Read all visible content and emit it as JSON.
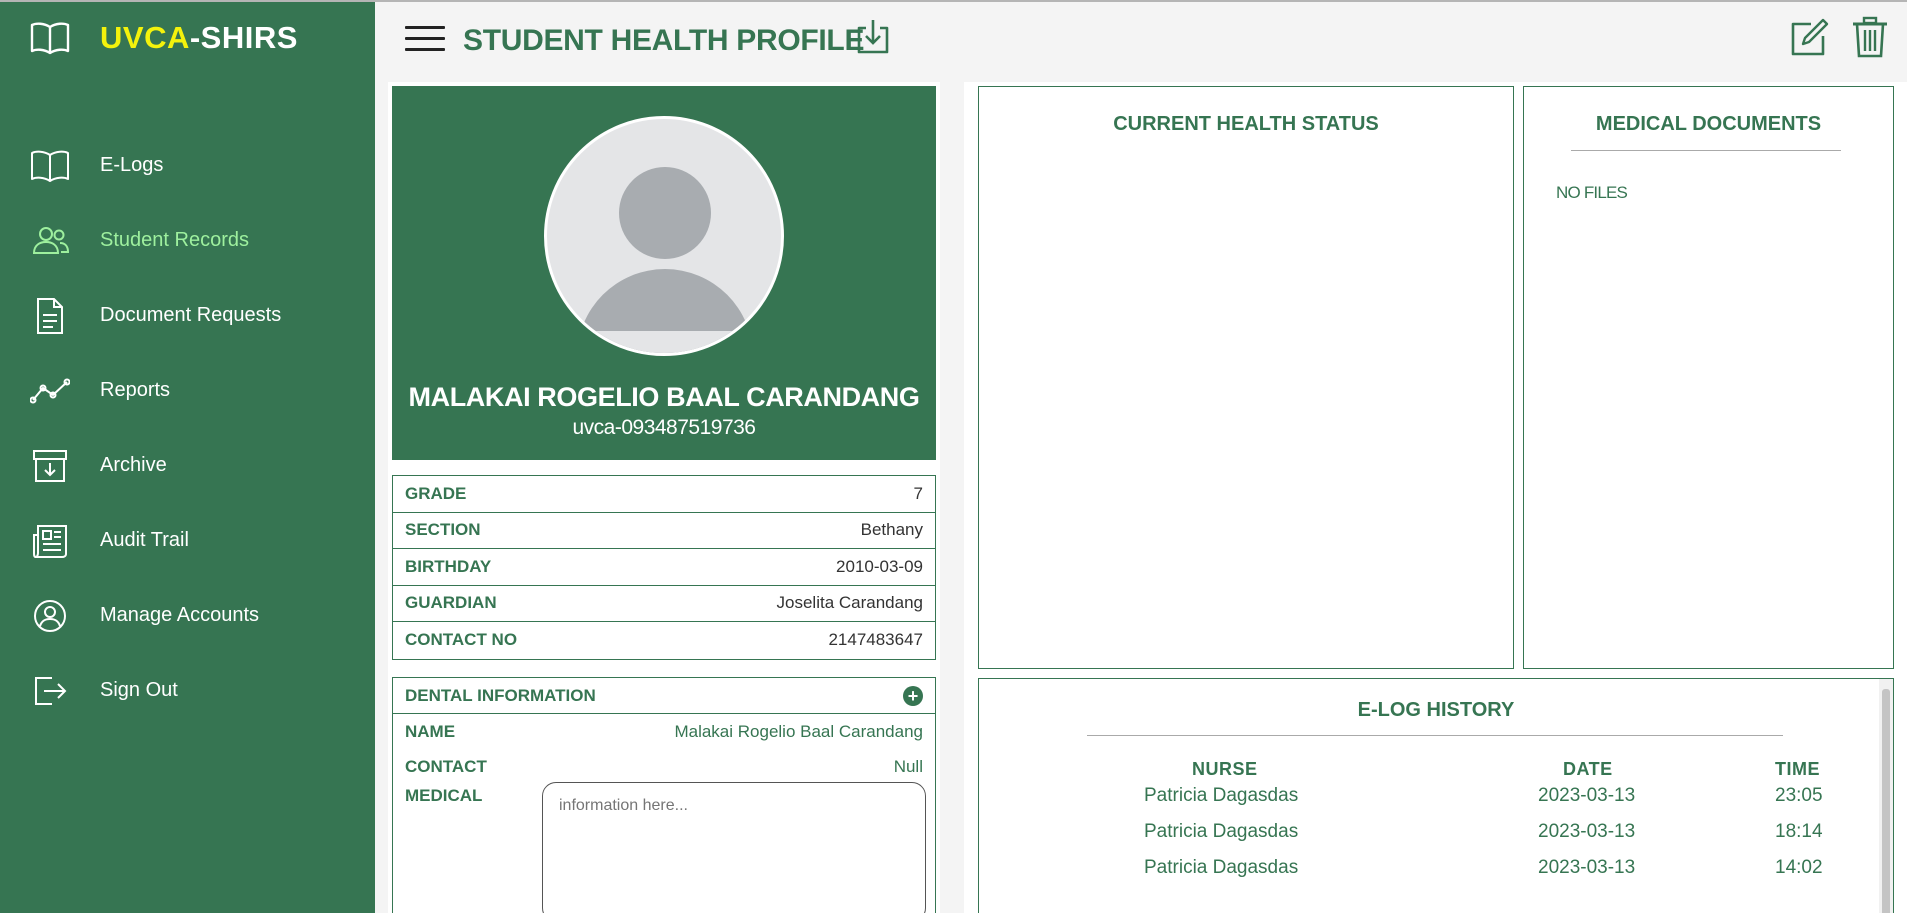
{
  "brand": {
    "part1": "UVCA",
    "part2": "-SHIRS"
  },
  "sidebar": {
    "items": [
      {
        "label": "E-Logs",
        "icon": "book-icon"
      },
      {
        "label": "Student Records",
        "icon": "users-icon",
        "active": true
      },
      {
        "label": "Document Requests",
        "icon": "document-icon"
      },
      {
        "label": "Reports",
        "icon": "chart-line-icon"
      },
      {
        "label": "Archive",
        "icon": "archive-icon"
      },
      {
        "label": "Audit Trail",
        "icon": "newspaper-icon"
      },
      {
        "label": "Manage Accounts",
        "icon": "user-circle-icon"
      },
      {
        "label": "Sign Out",
        "icon": "sign-out-icon"
      }
    ]
  },
  "header": {
    "title": "STUDENT HEALTH PROFILE"
  },
  "student": {
    "name": "MALAKAI ROGELIO BAAL CARANDANG",
    "id": "uvca-093487519736",
    "info": [
      {
        "key": "GRADE",
        "value": "7"
      },
      {
        "key": "SECTION",
        "value": "Bethany"
      },
      {
        "key": "BIRTHDAY",
        "value": "2010-03-09"
      },
      {
        "key": "GUARDIAN",
        "value": "Joselita Carandang"
      },
      {
        "key": "CONTACT NO",
        "value": "2147483647"
      }
    ]
  },
  "dental": {
    "title": "DENTAL INFORMATION",
    "name_label": "NAME",
    "name_value": "Malakai Rogelio Baal Carandang",
    "contact_label": "CONTACT",
    "contact_value": "Null",
    "medical_label": "MEDICAL",
    "medical_placeholder": "information here..."
  },
  "health": {
    "title": "CURRENT HEALTH STATUS"
  },
  "documents": {
    "title": "MEDICAL DOCUMENTS",
    "empty_text": "NO FILES"
  },
  "elog": {
    "title": "E-LOG HISTORY",
    "columns": [
      "NURSE",
      "DATE",
      "TIME"
    ],
    "rows": [
      {
        "nurse": "Patricia Dagasdas",
        "date": "2023-03-13",
        "time": "23:05"
      },
      {
        "nurse": "Patricia Dagasdas",
        "date": "2023-03-13",
        "time": "18:14"
      },
      {
        "nurse": "Patricia Dagasdas",
        "date": "2023-03-13",
        "time": "14:02"
      }
    ]
  },
  "colors": {
    "primary": "#367552",
    "brand_highlight": "#f4f20c",
    "active_nav": "#9ef09e"
  }
}
